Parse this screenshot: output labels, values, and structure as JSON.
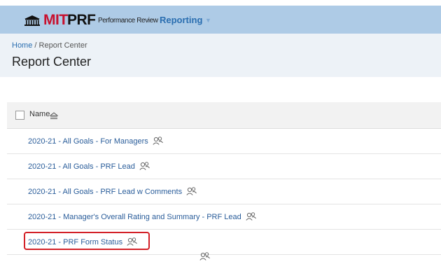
{
  "topbar": {
    "brand_mit": "MIT",
    "brand_prf": "PRF",
    "brand_sub": "Performance Review",
    "menu_reporting": "Reporting"
  },
  "breadcrumb": {
    "home": "Home",
    "separator": " / ",
    "current": "Report Center"
  },
  "page_title": "Report Center",
  "table": {
    "column_name": "Name",
    "rows": [
      {
        "label": "2020-21 - All Goals - For Managers",
        "icon": "shared-users-icon"
      },
      {
        "label": "2020-21 - All Goals - PRF Lead",
        "icon": "shared-users-icon"
      },
      {
        "label": "2020-21 - All Goals - PRF Lead w Comments",
        "icon": "shared-users-icon"
      },
      {
        "label": "2020-21 - Manager's Overall Rating and Summary - PRF Lead",
        "icon": "shared-users-icon"
      },
      {
        "label": "2020-21 - PRF Form Status",
        "icon": "shared-users-icon",
        "highlighted": true
      }
    ]
  },
  "colors": {
    "topbar_bg": "#aecbe6",
    "brand_red": "#c8102e",
    "link_blue": "#2a5d9a",
    "highlight_red": "#d32027"
  }
}
